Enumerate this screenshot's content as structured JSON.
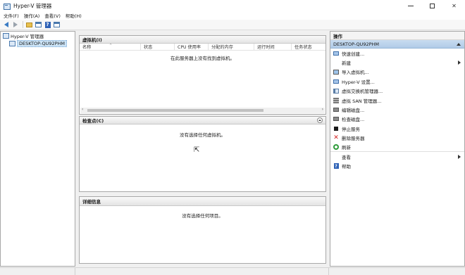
{
  "window": {
    "title": "Hyper-V 管理器",
    "controls": {
      "minimize": "—",
      "maximize": "☐",
      "close": "✕"
    }
  },
  "menu": [
    "文件(F)",
    "操作(A)",
    "查看(V)",
    "帮助(H)"
  ],
  "toolbar_icons": [
    "back-arrow-icon",
    "forward-arrow-icon",
    "folder-up-icon",
    "show-pane-icon",
    "help-icon",
    "action-pane-icon"
  ],
  "tree": {
    "root": "Hyper-V 管理器",
    "child": "DESKTOP-QU92PHM"
  },
  "vm_panel": {
    "title": "虚拟机(I)",
    "columns": [
      "名称",
      "状态",
      "CPU 使用率",
      "分配的内存",
      "运行时间",
      "任务状态"
    ],
    "empty_message": "在此服务器上没有找到虚拟机。"
  },
  "checkpoint_panel": {
    "title": "检查点(C)",
    "empty_message": "没有选择任何虚拟机。"
  },
  "details_panel": {
    "title": "详细信息",
    "empty_message": "没有选择任何项目。"
  },
  "actions": {
    "title": "操作",
    "subtitle": "DESKTOP-QU92PHM",
    "items": [
      {
        "label": "快速创建...",
        "icon": "quick-create-icon",
        "submenu": false
      },
      {
        "label": "新建",
        "icon": "",
        "submenu": true
      },
      {
        "label": "导入虚拟机...",
        "icon": "import-vm-icon",
        "submenu": false
      },
      {
        "label": "Hyper-V 设置...",
        "icon": "settings-icon",
        "submenu": false
      },
      {
        "label": "虚拟交换机管理器...",
        "icon": "switch-icon",
        "submenu": false
      },
      {
        "label": "虚拟 SAN 管理器...",
        "icon": "san-icon",
        "submenu": false
      },
      {
        "label": "编辑磁盘...",
        "icon": "edit-disk-icon",
        "submenu": false
      },
      {
        "label": "检查磁盘...",
        "icon": "inspect-disk-icon",
        "submenu": false
      },
      {
        "label": "停止服务",
        "icon": "stop-icon",
        "submenu": false
      },
      {
        "label": "删除服务器",
        "icon": "delete-icon",
        "submenu": false
      },
      {
        "label": "刷新",
        "icon": "refresh-icon",
        "submenu": false
      },
      {
        "label": "查看",
        "icon": "",
        "submenu": true
      },
      {
        "label": "帮助",
        "icon": "help-icon",
        "submenu": false
      }
    ]
  }
}
